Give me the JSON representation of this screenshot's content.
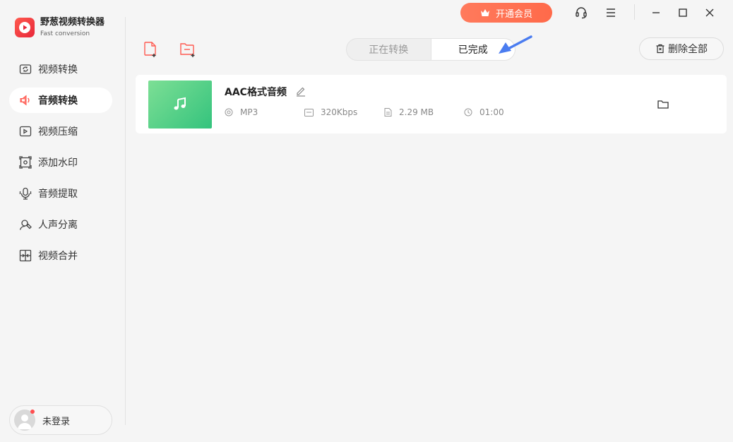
{
  "app": {
    "title": "野葱视频转换器",
    "subtitle": "Fast conversion",
    "brand_color": "#ff4d4f"
  },
  "sidebar": {
    "items": [
      {
        "label": "视频转换",
        "icon": "video-convert-icon",
        "active": false
      },
      {
        "label": "音频转换",
        "icon": "audio-convert-icon",
        "active": true
      },
      {
        "label": "视频压缩",
        "icon": "video-compress-icon",
        "active": false
      },
      {
        "label": "添加水印",
        "icon": "watermark-icon",
        "active": false
      },
      {
        "label": "音频提取",
        "icon": "audio-extract-icon",
        "active": false
      },
      {
        "label": "人声分离",
        "icon": "vocal-separate-icon",
        "active": false
      },
      {
        "label": "视频合并",
        "icon": "video-merge-icon",
        "active": false
      }
    ],
    "user_label": "未登录"
  },
  "topbar": {
    "vip_label": "开通会员",
    "vip_color": "#ff6f52"
  },
  "toolbar": {
    "tabs": [
      {
        "label": "正在转换",
        "active": false
      },
      {
        "label": "已完成",
        "active": true
      }
    ],
    "delete_all_label": "删除全部",
    "arrow_color": "#4a7cf0"
  },
  "files": [
    {
      "name": "AAC格式音频",
      "format": "MP3",
      "bitrate": "320Kbps",
      "size": "2.29 MB",
      "duration": "01:00"
    }
  ]
}
